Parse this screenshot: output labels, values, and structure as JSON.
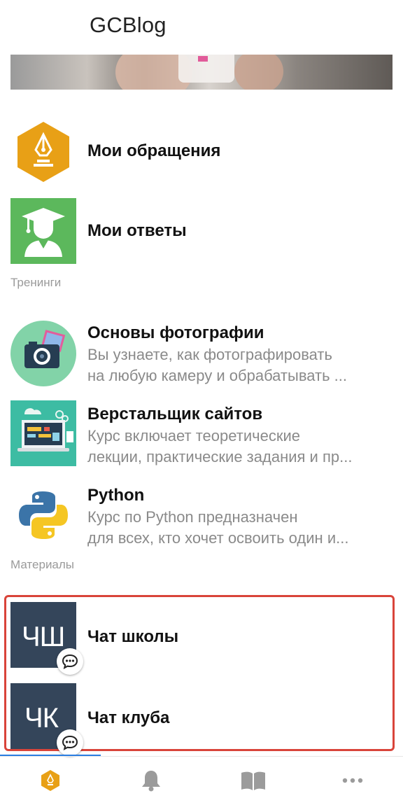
{
  "header": {
    "title": "GCBlog"
  },
  "menu": [
    {
      "label": "Мои обращения",
      "icon": "pen-hexagon-icon",
      "color": "#e8a016"
    },
    {
      "label": "Мои ответы",
      "icon": "graduate-icon",
      "color": "#5cb85c"
    }
  ],
  "trainings": {
    "section_label": "Тренинги",
    "items": [
      {
        "title": "Основы фотографии",
        "desc_line1": "Вы узнаете, как фотографировать",
        "desc_line2": "на любую камеру и обрабатывать ...",
        "icon": "camera-icon"
      },
      {
        "title": "Верстальщик сайтов",
        "desc_line1": "Курс включает теоретические",
        "desc_line2": "лекции, практические задания и пр...",
        "icon": "laptop-code-icon"
      },
      {
        "title": "Python",
        "desc_line1": "Курс по Python предназначен",
        "desc_line2": "для всех, кто хочет освоить один и...",
        "icon": "python-logo-icon"
      }
    ]
  },
  "materials": {
    "section_label": "Материалы",
    "chats": [
      {
        "initials": "ЧШ",
        "title": "Чат школы"
      },
      {
        "initials": "ЧК",
        "title": "Чат клуба"
      }
    ]
  },
  "bottom_nav": [
    {
      "icon": "home-pen-icon",
      "active": true
    },
    {
      "icon": "bell-icon",
      "active": false
    },
    {
      "icon": "book-icon",
      "active": false
    },
    {
      "icon": "more-dots-icon",
      "active": false
    }
  ],
  "colors": {
    "accent": "#e8a016",
    "active_tab": "#2a7de1",
    "highlight_frame": "#d9443a",
    "avatar_bg": "#34455a"
  }
}
